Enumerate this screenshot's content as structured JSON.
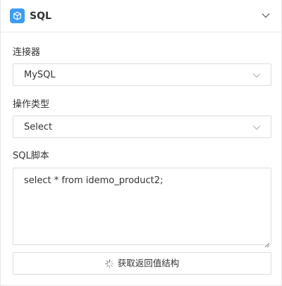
{
  "header": {
    "title": "SQL",
    "icon": "cube-icon",
    "icon_bg": "#3c9cf7",
    "collapse_icon": "chevron-down-icon"
  },
  "connector": {
    "label": "连接器",
    "value": "MySQL"
  },
  "operation": {
    "label": "操作类型",
    "value": "Select"
  },
  "script": {
    "label": "SQL脚本",
    "value": "select * from idemo_product2;"
  },
  "fetch_button": {
    "label": "获取返回值结构",
    "icon": "loading-spinner-icon"
  }
}
